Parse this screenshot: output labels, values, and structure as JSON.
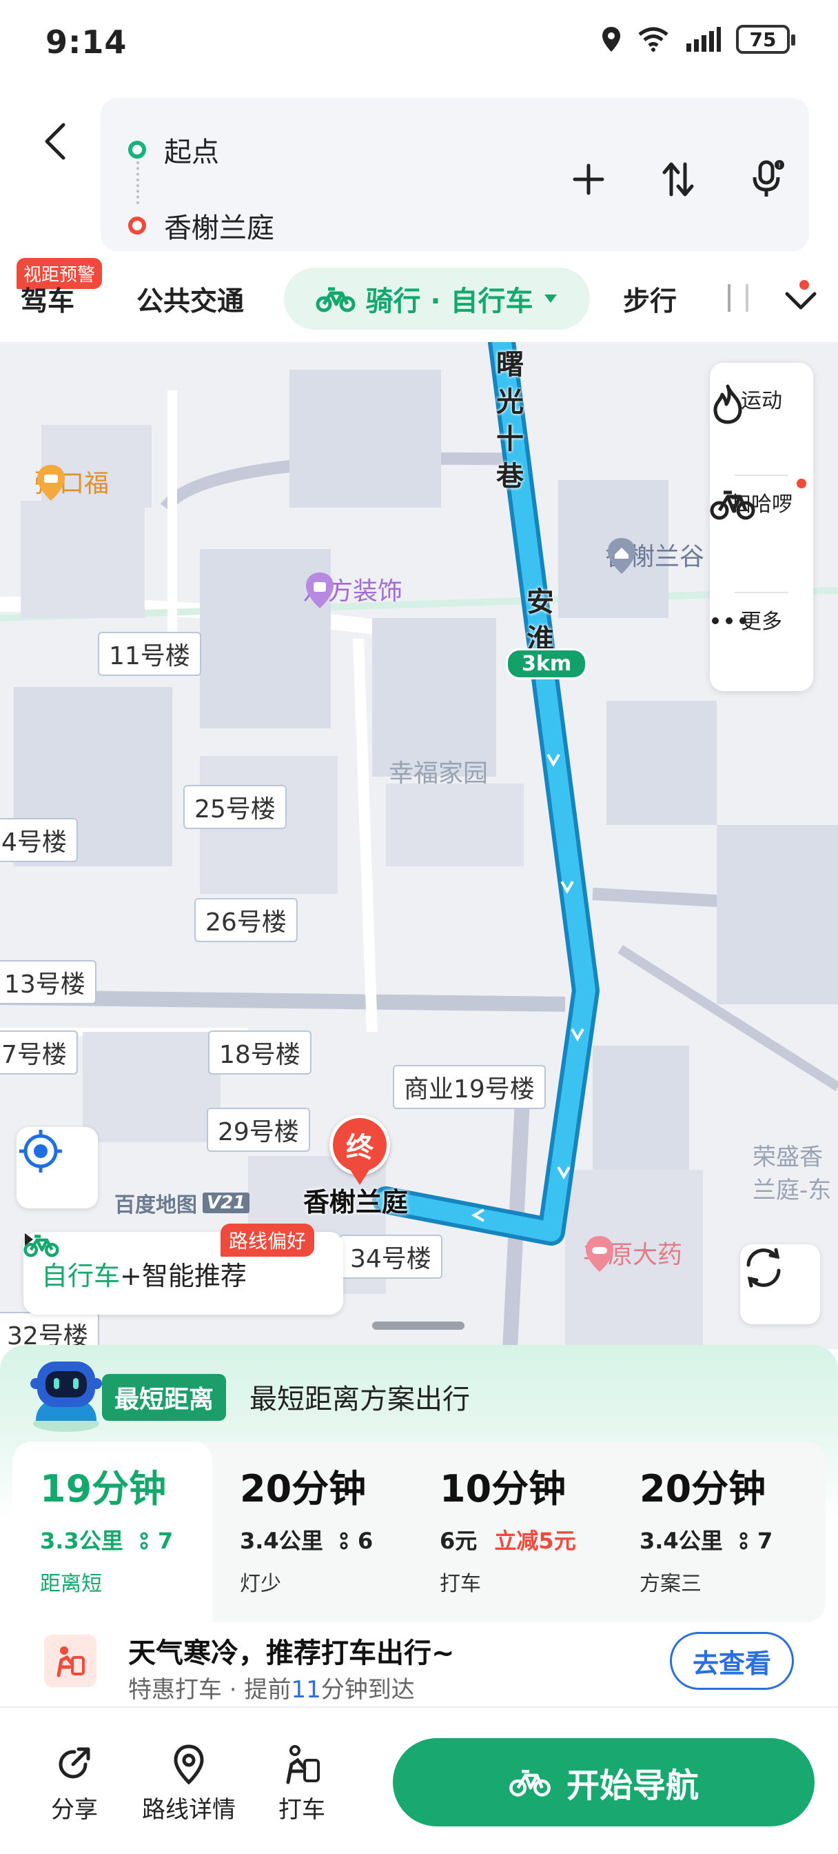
{
  "status_bar": {
    "time": "9:14",
    "battery": "75"
  },
  "route": {
    "start": "起点",
    "destination": "香榭兰庭"
  },
  "tabs": {
    "drive_badge": "视距预警",
    "drive": "驾车",
    "transit": "公共交通",
    "active": "骑行 · 自行车",
    "walk": "步行"
  },
  "map": {
    "poi_porridge": "粥口福",
    "poi_bafang": "八方装饰",
    "poi_xiangxie": "香榭兰谷",
    "community": "幸福家园",
    "road_shuguang": "曙光十巷",
    "road_anhuai": "安淮",
    "distance_chip": "3km",
    "buildings": {
      "b11": "11号楼",
      "b25": "25号楼",
      "b4": "4号楼",
      "b26": "26号楼",
      "b13": "13号楼",
      "b7": "7号楼",
      "b18": "18号楼",
      "b_commerce19": "商业19号楼",
      "b29": "29号楼",
      "b34": "34号楼",
      "b32": "32号楼"
    },
    "poi_rongsheng": "荣盛香兰庭-东",
    "poi_fengyuan": "丰原大药",
    "end_marker": "终",
    "end_name": "香榭兰庭",
    "watermark": "百度地图",
    "watermark_version": "V21",
    "preference_badge": "路线偏好",
    "preference_bike": "自行车",
    "preference_smart": "+智能推荐"
  },
  "side_tools": {
    "sport": "运动",
    "scan": "扫哈啰",
    "more": "更多"
  },
  "panel": {
    "badge": "最短距离",
    "hint": "最短距离方案出行",
    "plans": [
      {
        "time": "19分钟",
        "distance": "3.3公里",
        "lights": "7",
        "tag": "距离短"
      },
      {
        "time": "20分钟",
        "distance": "3.4公里",
        "lights": "6",
        "tag": "灯少"
      },
      {
        "time": "10分钟",
        "price": "6元",
        "discount": "立减5元",
        "tag": "打车"
      },
      {
        "time": "20分钟",
        "distance": "3.4公里",
        "lights": "7",
        "tag": "方案三"
      }
    ],
    "weather_title": "天气寒冷，推荐打车出行~",
    "weather_sub_prefix": "特惠打车 · 提前",
    "weather_sub_minutes": "11",
    "weather_sub_suffix": "分钟到达",
    "check_button": "去查看"
  },
  "bottom_bar": {
    "share": "分享",
    "route_detail": "路线详情",
    "taxi": "打车",
    "start_nav": "开始导航"
  },
  "colors": {
    "accent": "#19a86f",
    "route": "#2fb4e8",
    "alert": "#f04a3c",
    "link": "#2a6fdb"
  }
}
